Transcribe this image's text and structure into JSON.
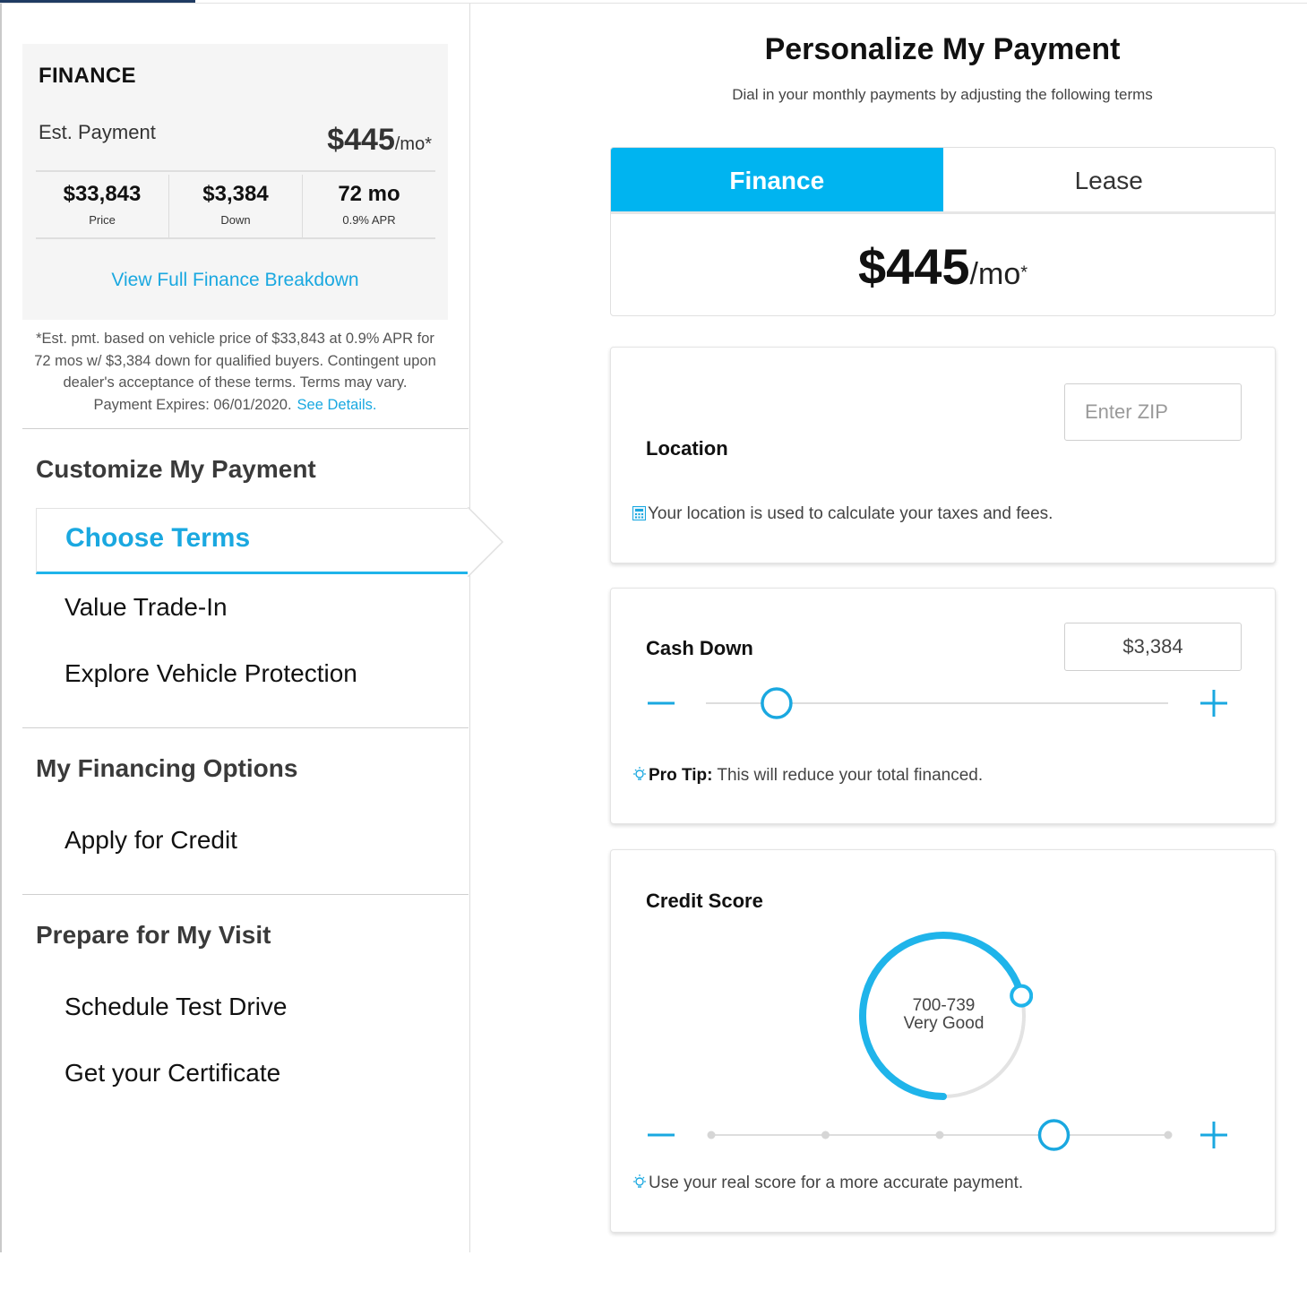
{
  "sidebar": {
    "finance_card": {
      "title": "FINANCE",
      "est_label": "Est. Payment",
      "payment_amount": "$445",
      "payment_unit": "/mo*",
      "stats": [
        {
          "value": "$33,843",
          "label": "Price"
        },
        {
          "value": "$3,384",
          "label": "Down"
        },
        {
          "value": "72 mo",
          "label": "0.9% APR"
        }
      ],
      "breakdown_link": "View Full Finance Breakdown"
    },
    "disclaimer": {
      "line1": "*Est. pmt. based on vehicle price of $33,843 at 0.9% APR for",
      "line2": "72 mos w/ $3,384 down for qualified buyers. Contingent upon",
      "line3": "dealer's acceptance of these terms. Terms may vary.",
      "line4": "Payment Expires: 06/01/2020.",
      "details_link": "See Details."
    },
    "sections": [
      {
        "title": "Customize My Payment",
        "items": [
          "Choose Terms",
          "Value Trade-In",
          "Explore Vehicle Protection"
        ]
      },
      {
        "title": "My Financing Options",
        "items": [
          "Apply for Credit"
        ]
      },
      {
        "title": "Prepare for My Visit",
        "items": [
          "Schedule Test Drive",
          "Get your Certificate"
        ]
      }
    ],
    "active_item": "Choose Terms"
  },
  "main": {
    "title": "Personalize My Payment",
    "subtitle": "Dial in your monthly payments by adjusting the following terms",
    "tabs": [
      {
        "label": "Finance",
        "active": true
      },
      {
        "label": "Lease",
        "active": false
      }
    ],
    "payment": {
      "amount": "$445",
      "unit": "/mo",
      "star": "*"
    },
    "location": {
      "label": "Location",
      "zip_placeholder": "Enter ZIP",
      "zip_value": "",
      "note": "Your location is used to calculate your taxes and fees."
    },
    "cash_down": {
      "label": "Cash Down",
      "value": "$3,384",
      "slider_fraction": 0.13,
      "tip_label": "Pro Tip:",
      "tip_text": "This will reduce your total financed."
    },
    "credit_score": {
      "label": "Credit Score",
      "range": "700-739",
      "rating": "Very Good",
      "gauge_fraction": 0.71,
      "selected_step": 4,
      "steps": 5,
      "note": "Use your real score for a more accurate payment."
    }
  },
  "colors": {
    "accent": "#00b4f0",
    "link": "#1aa8e0",
    "topbar": "#1f3b62"
  }
}
